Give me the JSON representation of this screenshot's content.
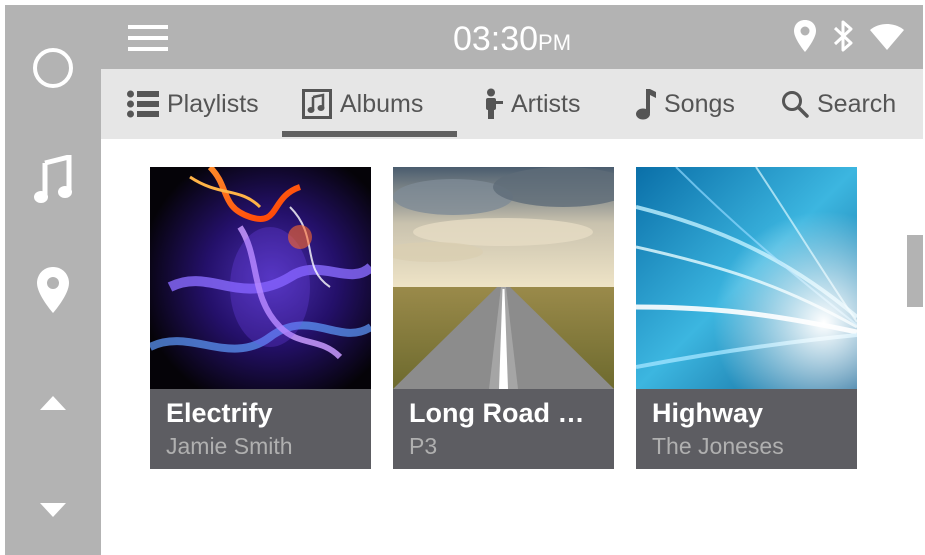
{
  "status": {
    "time": "03:30",
    "ampm": "PM",
    "icons": [
      "location-icon",
      "bluetooth-icon",
      "wifi-icon"
    ]
  },
  "rail": {
    "items": [
      {
        "name": "home",
        "icon": "circle-icon"
      },
      {
        "name": "music",
        "icon": "music-note-icon"
      },
      {
        "name": "navigation",
        "icon": "location-pin-icon"
      },
      {
        "name": "scroll-up",
        "icon": "triangle-up-icon"
      },
      {
        "name": "scroll-down",
        "icon": "triangle-down-icon"
      }
    ]
  },
  "tabs": [
    {
      "label": "Playlists",
      "icon": "list-icon"
    },
    {
      "label": "Albums",
      "icon": "album-icon",
      "active": true
    },
    {
      "label": "Artists",
      "icon": "artist-mic-icon"
    },
    {
      "label": "Songs",
      "icon": "note-icon"
    },
    {
      "label": "Search",
      "icon": "search-icon"
    }
  ],
  "albums": [
    {
      "title": "Electrify",
      "artist": "Jamie Smith"
    },
    {
      "title": "Long Road H...",
      "artist": "P3"
    },
    {
      "title": "Highway",
      "artist": "The Joneses"
    }
  ],
  "colors": {
    "chrome": "#b3b3b3",
    "tabbar": "#e6e6e6",
    "caption": "#5d5d62",
    "text_muted": "#555555"
  }
}
